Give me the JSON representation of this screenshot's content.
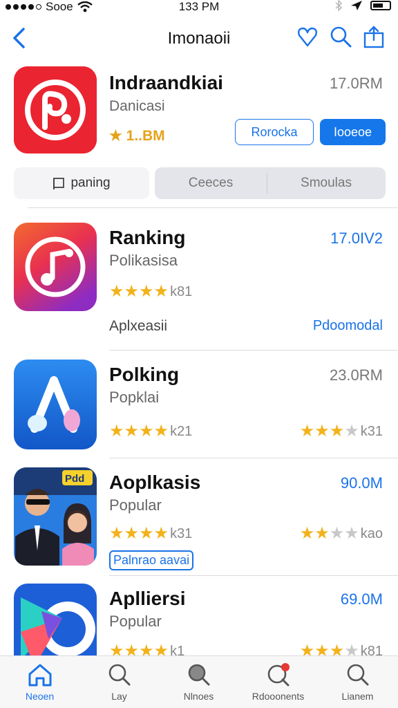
{
  "status_bar": {
    "carrier": "Sooe",
    "time": "133 PM"
  },
  "nav": {
    "title": "Imonaoii"
  },
  "header_app": {
    "name": "Indraandkiai",
    "subtitle": "Danicasi",
    "size": "17.0RM",
    "rating": "1..BM",
    "button_outline": "Rorocka",
    "button_fill": "Iooeoe"
  },
  "tabs": {
    "tab1": "paning",
    "tab2": "Ceeces",
    "tab3": "Smoulas"
  },
  "rows": [
    {
      "name": "Ranking",
      "subtitle": "Polikasisa",
      "size": "17.0IV2",
      "rating_count": "k81",
      "meta": "Aplxeasii",
      "link": "Pdoomodal"
    },
    {
      "name": "Polking",
      "subtitle": "Popklai",
      "size": "23.0RM",
      "rating_count": "k21",
      "rating_count_right": "k31"
    },
    {
      "name": "Aoplkasis",
      "subtitle": "Popular",
      "size": "90.0M",
      "rating_count": "k31",
      "rating_count_right": "kao",
      "chip": "Palnrao aavai",
      "icon_text": "Pdd"
    },
    {
      "name": "Aplliersi",
      "subtitle": "Popular",
      "size": "69.0M",
      "rating_count": "k1",
      "rating_count_right": "k81"
    }
  ],
  "tab_bar": {
    "items": [
      {
        "label": "Neoen",
        "icon": "home-icon"
      },
      {
        "label": "Lay",
        "icon": "search-icon"
      },
      {
        "label": "Nlnoes",
        "icon": "search-filled-icon"
      },
      {
        "label": "Rdooonents",
        "icon": "updates-icon"
      },
      {
        "label": "Lianem",
        "icon": "search-icon"
      }
    ]
  },
  "colors": {
    "accent": "#1a73e8",
    "star": "#f2b21b"
  }
}
